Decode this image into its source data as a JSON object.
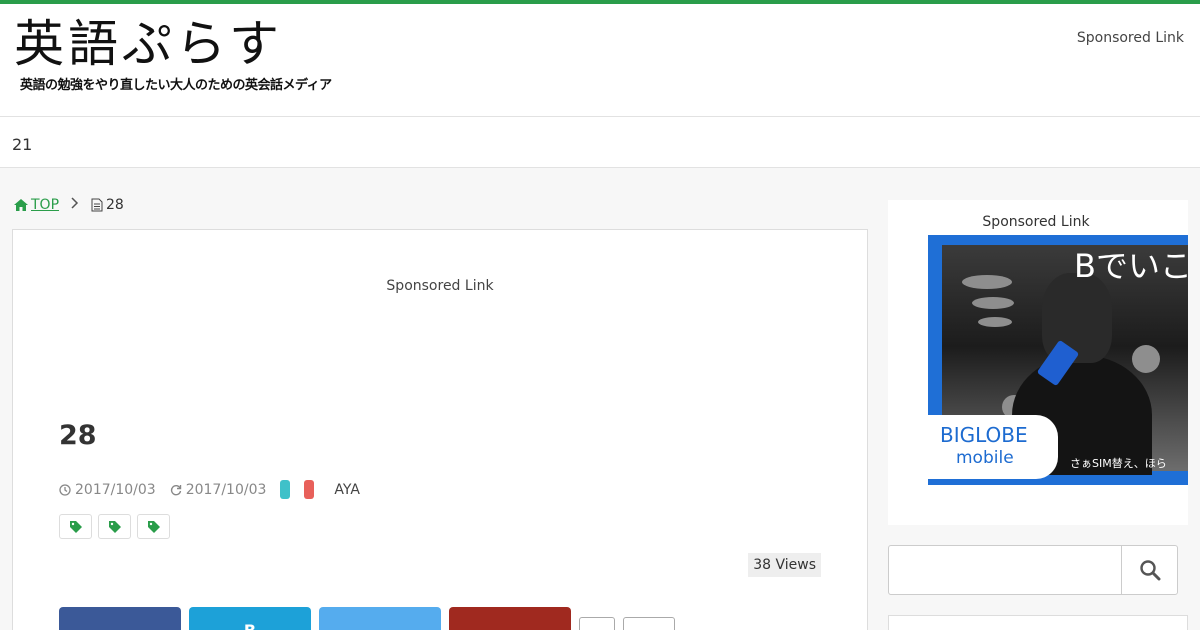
{
  "colors": {
    "accent": "#2a9d4a",
    "cat1": "#3fc1c9",
    "cat2": "#e8605a",
    "facebook": "#3b5998",
    "hatena": "#1da1d8",
    "twitter": "#55acee",
    "pocket": "#a0291f"
  },
  "header": {
    "logo": "英語ぷらす",
    "tagline": "英語の勉強をやり直したい大人のための英会話メディア",
    "sponsor": "Sponsored Link"
  },
  "subbar": {
    "text": "21"
  },
  "breadcrumb": {
    "home": "TOP",
    "current": "28"
  },
  "article": {
    "sponsor": "Sponsored Link",
    "title": "28",
    "published": "2017/10/03",
    "updated": "2017/10/03",
    "author": "AYA",
    "views": "38 Views",
    "share": {
      "hatena_label": "B",
      "count_a": "",
      "count_b": ""
    }
  },
  "sidebar": {
    "sponsor": "Sponsored Link",
    "ad": {
      "headline": "Bでいこ",
      "logo": "BIGLOBE",
      "logo_sub": "mobile",
      "tagline": "さぁSIM替え、ほら"
    },
    "search": {
      "placeholder": ""
    }
  }
}
